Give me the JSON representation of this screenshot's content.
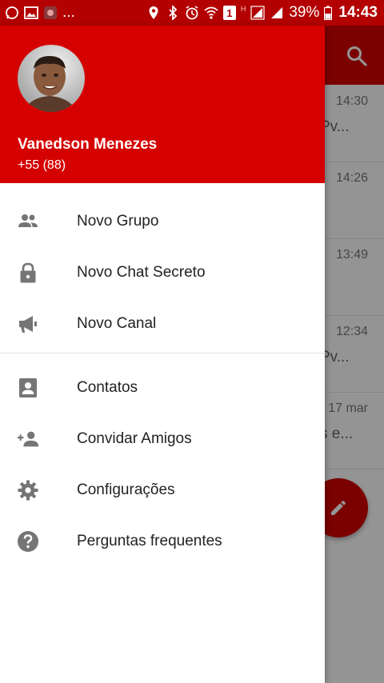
{
  "statusbar": {
    "battery": "39%",
    "time": "14:43",
    "more": "...",
    "sim": "1",
    "h_indicator": "H",
    "icons": [
      "whatsapp-icon",
      "gallery-icon",
      "app-icon",
      "location-icon",
      "bluetooth-icon",
      "alarm-icon",
      "wifi-icon",
      "sim-icon",
      "signal-icon",
      "signal-icon",
      "battery-icon"
    ]
  },
  "background": {
    "rows": [
      {
        "time": "14:30",
        "snippet": "Pv..."
      },
      {
        "time": "14:26",
        "snippet": ""
      },
      {
        "time": "13:49",
        "snippet": ""
      },
      {
        "time": "12:34",
        "snippet": "Pv..."
      },
      {
        "time": "17 mar",
        "snippet": "s e..."
      }
    ]
  },
  "drawer": {
    "user": {
      "name": "Vanedson Menezes",
      "phone": "+55 (88)"
    },
    "menu_group1": [
      {
        "label": "Novo Grupo",
        "icon": "group-icon"
      },
      {
        "label": "Novo Chat Secreto",
        "icon": "lock-icon"
      },
      {
        "label": "Novo Canal",
        "icon": "megaphone-icon"
      }
    ],
    "menu_group2": [
      {
        "label": "Contatos",
        "icon": "contact-icon"
      },
      {
        "label": "Convidar Amigos",
        "icon": "add-person-icon"
      },
      {
        "label": "Configurações",
        "icon": "gear-icon"
      },
      {
        "label": "Perguntas frequentes",
        "icon": "help-icon"
      }
    ]
  },
  "colors": {
    "primary": "#d50000",
    "statusbar": "#b30000",
    "icon_gray": "#757575"
  }
}
